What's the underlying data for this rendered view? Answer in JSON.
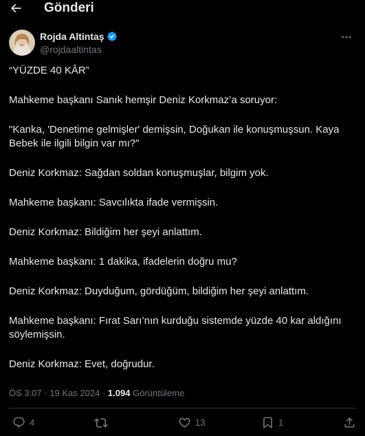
{
  "header": {
    "title": "Gönderi",
    "back_icon": "arrow-left-icon"
  },
  "author": {
    "display_name": "Rojda Altintaş",
    "handle": "@rojdaaltintas",
    "verified": true,
    "verified_color": "#1d9bf0"
  },
  "tweet": {
    "paragraphs": [
      "“YÜZDE 40 KÂR”",
      "Mahkeme başkanı Sanık hemşir Deniz Korkmaz’a soruyor:",
      "\"Kanka, 'Denetime gelmişler' demişsin, Doğukan ile konuşmuşsun. Kaya Bebek ile ilgili bilgin var mı?\"",
      "Deniz Korkmaz: Sağdan soldan konuşmuşlar, bilgim yok.",
      "Mahkeme başkanı: Savcılıkta ifade vermişsin.",
      "Deniz Korkmaz: Bildiğim her şeyi anlattım.",
      "Mahkeme başkanı: 1 dakika, ifadelerin doğru mu?",
      "Deniz Korkmaz: Duyduğum, gördüğüm, bildiğim her şeyi anlattım.",
      "Mahkeme başkanı: Fırat Sarı’nın kurduğu sistemde yüzde 40 kar aldığını söylemişsin.",
      "Deniz Korkmaz: Evet, doğrudur."
    ]
  },
  "meta": {
    "time": "ÖS 3:07",
    "date": "19 Kas 2024",
    "separator": "·",
    "views_count": "1.094",
    "views_label": "Görüntüleme"
  },
  "actions": {
    "reply_count": "4",
    "retweet_count": "",
    "like_count": "13",
    "bookmark_count": "1"
  },
  "colors": {
    "background": "#000000",
    "text_primary": "#e7e9ea",
    "text_secondary": "#71767b",
    "divider": "#2f3336",
    "accent": "#1d9bf0"
  }
}
